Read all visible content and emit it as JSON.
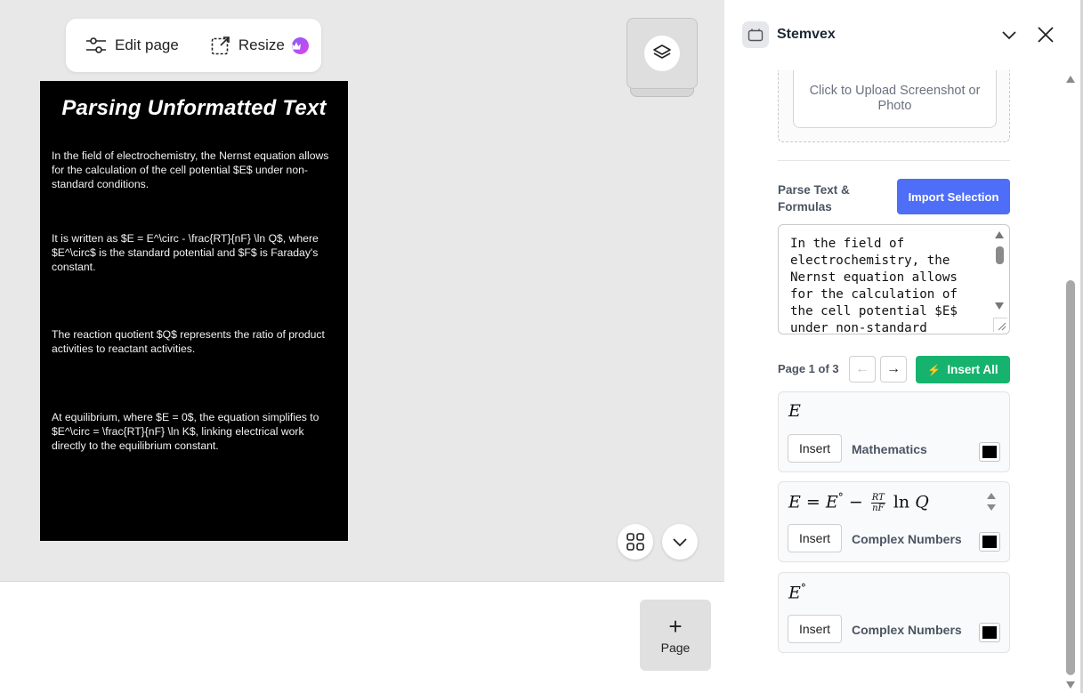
{
  "toolbar": {
    "edit_page_label": "Edit page",
    "resize_label": "Resize"
  },
  "document": {
    "title": "Parsing Unformatted Text",
    "paragraphs": [
      "In the field of electrochemistry, the Nernst equation allows for the calculation of the cell potential $E$ under non-standard conditions.",
      "It is written as $E = E^\\circ - \\frac{RT}{nF} \\ln Q$, where $E^\\circ$ is the standard potential and $F$ is Faraday's constant.",
      "The reaction quotient $Q$ represents the ratio of product activities to reactant activities.",
      "At equilibrium, where $E = 0$, the equation simplifies to $E^\\circ = \\frac{RT}{nF} \\ln K$, linking electrical work directly to the equilibrium constant."
    ]
  },
  "add_page": {
    "plus": "+",
    "label": "Page"
  },
  "panel": {
    "app_name": "Stemvex",
    "upload_text": "Click to Upload Screenshot or Photo",
    "parse_label": "Parse Text & Formulas",
    "import_button": "Import Selection",
    "textarea_value": "In the field of electrochemistry, the Nernst equation allows for the calculation of the cell potential $E$ under non-standard conditions.",
    "pager": {
      "label": "Page 1 of 3",
      "prev": "←",
      "next": "→",
      "insert_all": "Insert All",
      "insert_all_icon": "⚡"
    },
    "cards": [
      {
        "formula_text": "E",
        "insert_label": "Insert",
        "category": "Mathematics",
        "color": "#000000"
      },
      {
        "formula_lhs": "E",
        "formula_eq": "=",
        "formula_e": "E",
        "formula_circ": "°",
        "formula_minus": "−",
        "frac_num": "RT",
        "frac_den": "nF",
        "formula_ln": "ln",
        "formula_q": "Q",
        "insert_label": "Insert",
        "category": "Complex Numbers",
        "color": "#000000"
      },
      {
        "formula_text": "E",
        "formula_circ": "°",
        "insert_label": "Insert",
        "category": "Complex Numbers",
        "color": "#000000"
      }
    ]
  },
  "icons": {
    "edit": "sliders-icon",
    "resize": "resize-icon",
    "premium": "crown-icon",
    "layers": "layers-icon",
    "grid": "grid-icon",
    "expand": "chevron-down-icon",
    "app": "app-icon",
    "collapse": "chevron-down-icon",
    "close": "close-icon"
  },
  "colors": {
    "accent_blue": "#4f6ef7",
    "accent_green": "#16b36e",
    "canvas_bg": "#e8e8e8",
    "page_bg": "#000000"
  }
}
